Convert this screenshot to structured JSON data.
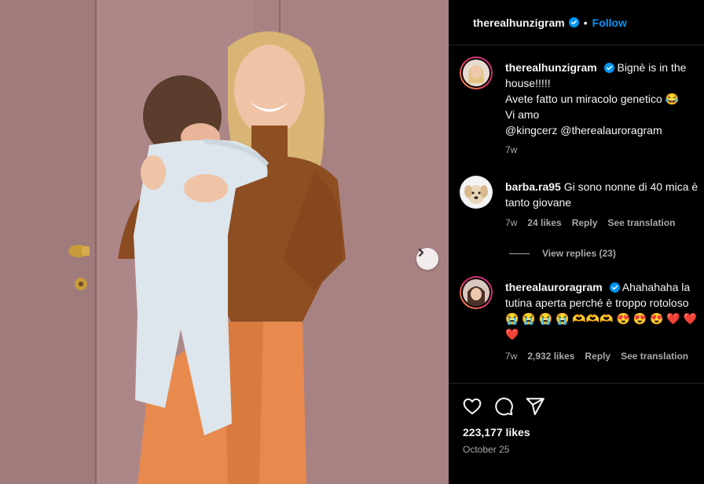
{
  "post": {
    "author": "therealhunzigram",
    "follow_label": "Follow",
    "separator": "•"
  },
  "caption": {
    "username": "therealhunzigram",
    "line1": "Bignè is in the house!!!!!",
    "line2": "Avete fatto un miracolo genetico 😂",
    "line3": "Vi amo",
    "line4": "@kingcerz @therealauroragram",
    "time": "7w"
  },
  "comments": [
    {
      "username": "barba.ra95",
      "text": "Gi sono nonne di 40 mica è tanto giovane",
      "time": "7w",
      "likes": "24 likes",
      "reply": "Reply",
      "translate": "See translation"
    },
    {
      "username": "therealauroragram",
      "text": "Ahahahaha la tutina aperta perché è troppo rotoloso 😭 😭 😭 😭 🫶🫶🫶 😍 😍 😍 ❤️ ❤️ ❤️",
      "time": "7w",
      "likes": "2,932 likes",
      "reply": "Reply",
      "translate": "See translation"
    }
  ],
  "view_replies": "View replies (23)",
  "footer": {
    "likes": "223,177 likes",
    "date": "October 25"
  },
  "colors": {
    "accent": "#0095f6",
    "secondary_text": "#a8a8a8",
    "wall": "#a37e7f"
  }
}
